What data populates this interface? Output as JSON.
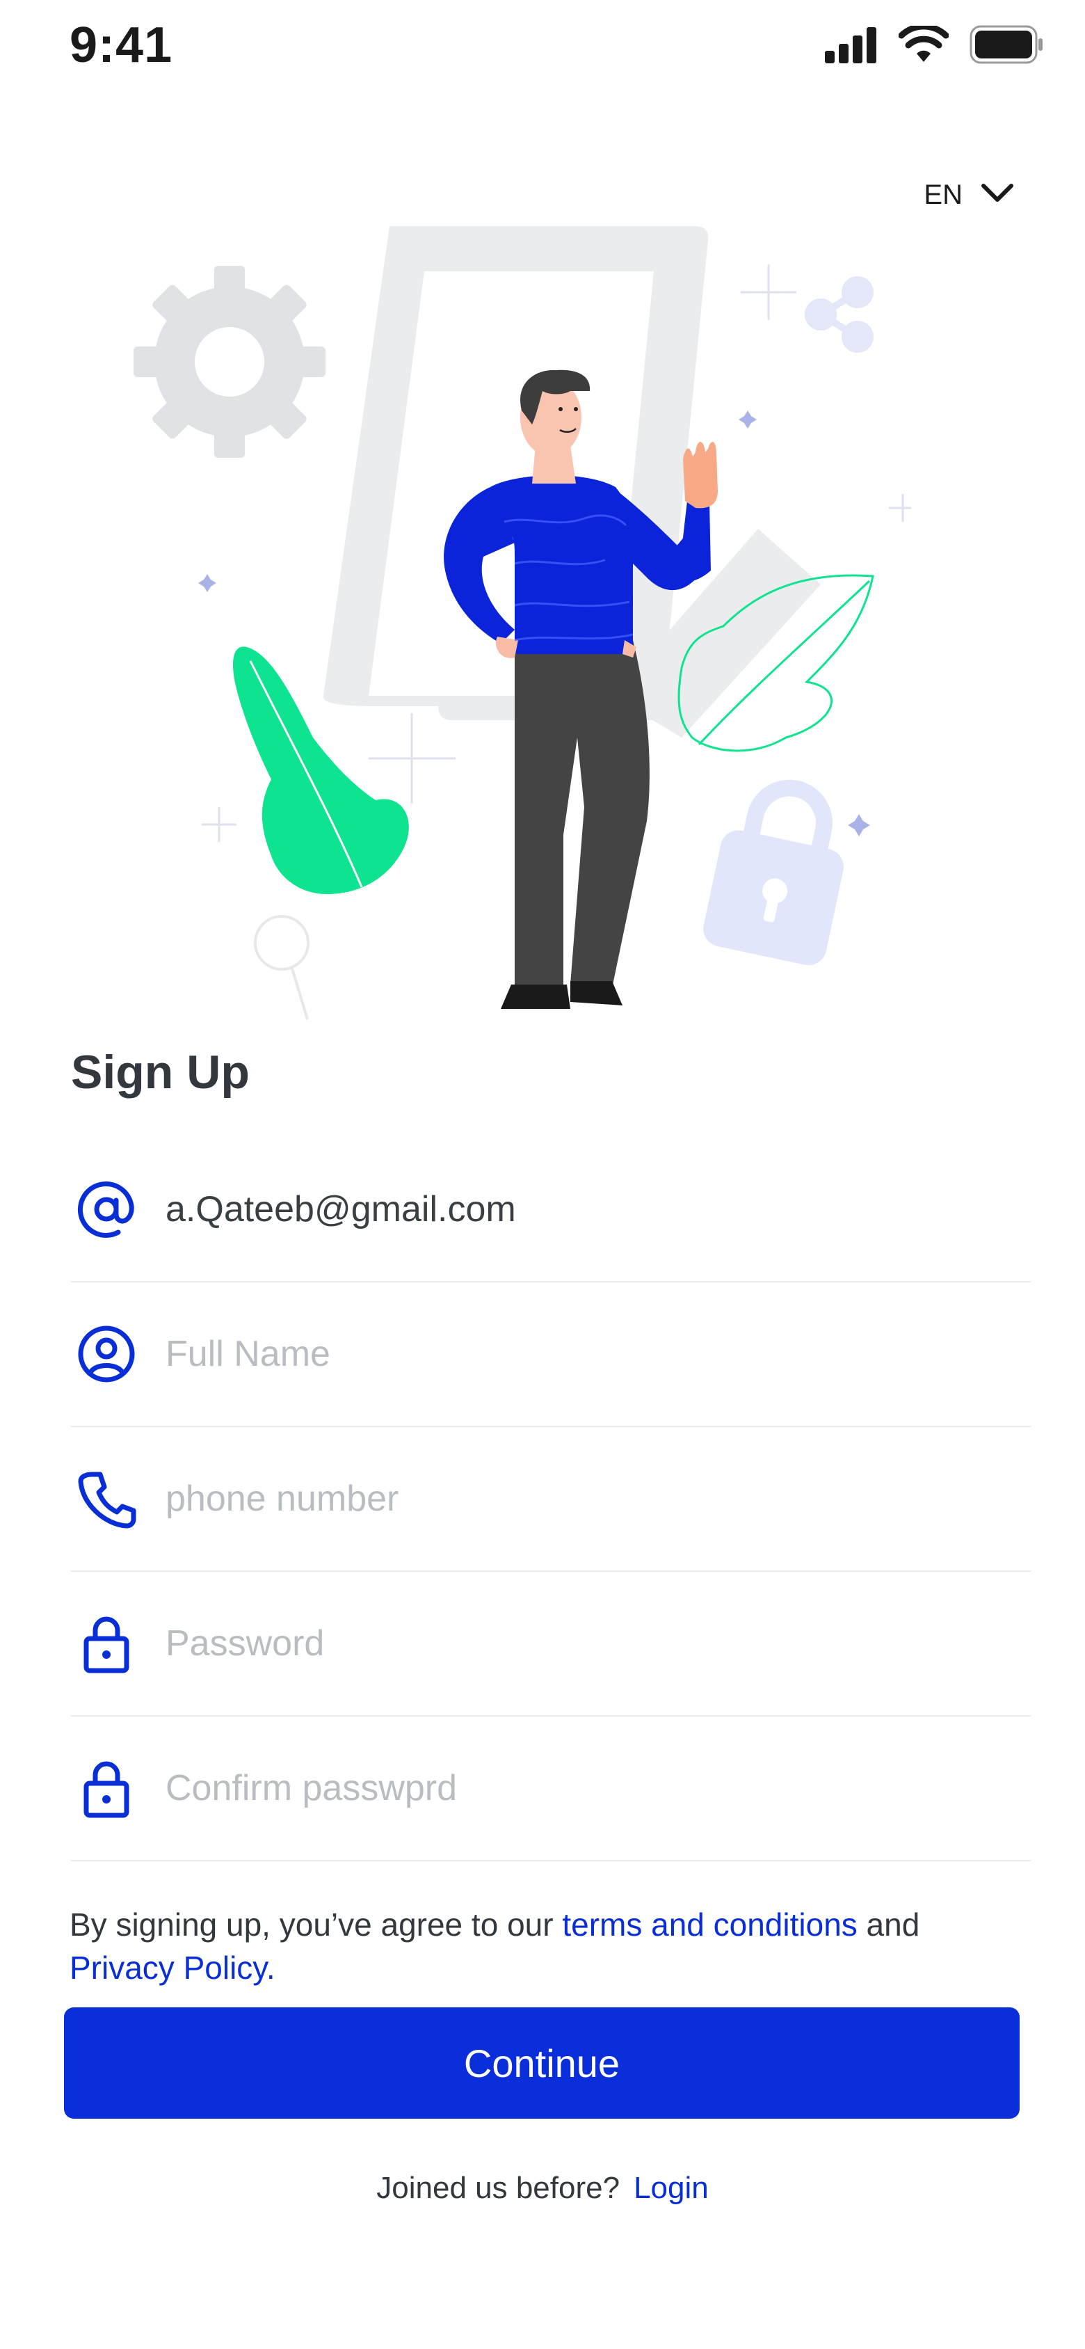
{
  "status_bar": {
    "time": "9:41",
    "icons": [
      "cellular-signal-icon",
      "wifi-icon",
      "battery-icon"
    ]
  },
  "language": {
    "value": "EN",
    "icon": "chevron-down-icon"
  },
  "page": {
    "title": "Sign Up"
  },
  "form": {
    "email": {
      "icon": "at-sign-icon",
      "value": "a.Qateeb@gmail.com",
      "placeholder": ""
    },
    "full_name": {
      "icon": "user-circle-icon",
      "value": "",
      "placeholder": "Full Name"
    },
    "phone": {
      "icon": "phone-icon",
      "value": "",
      "placeholder": "phone number"
    },
    "password": {
      "icon": "lock-icon",
      "value": "",
      "placeholder": "Password"
    },
    "confirm_password": {
      "icon": "lock-icon",
      "value": "",
      "placeholder": "Confirm passwprd"
    }
  },
  "terms": {
    "prefix": "By signing up, you’ve agree to our ",
    "terms_link": "terms and conditions",
    "middle": " and ",
    "privacy_link": "Privacy Policy."
  },
  "continue_button": {
    "label": "Continue"
  },
  "login": {
    "prompt": "Joined us before?",
    "link": "Login"
  },
  "colors": {
    "accent": "#0a2ed9",
    "text": "#32383d",
    "placeholder": "#b9bcc1",
    "divider": "#e8ebf3",
    "illustration_green": "#0ee38f",
    "illustration_gray": "#ebecee"
  }
}
